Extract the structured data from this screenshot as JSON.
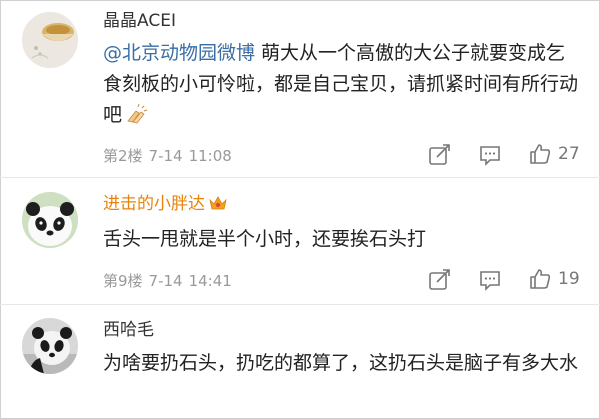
{
  "comments": [
    {
      "username": "晶晶ACEI",
      "mention": "@北京动物园微博",
      "text": " 萌大从一个高傲的大公子就要变成乞食刻板的小可怜啦，都是自己宝贝，请抓紧时间有所行动吧",
      "emoji": "clapping-hands-icon",
      "floor": "第2楼",
      "date": "7-14",
      "time": "11:08",
      "likes": "27"
    },
    {
      "username": "进击的小胖达",
      "badge": "vip-crown-icon",
      "text": "舌头一甩就是半个小时，还要挨石头打",
      "floor": "第9楼",
      "date": "7-14",
      "time": "14:41",
      "likes": "19"
    },
    {
      "username": "西哈毛",
      "text": "为啥要扔石头，扔吃的都算了，这扔石头是脑子有多大水"
    }
  ],
  "colors": {
    "mention": "#3a6ea5",
    "vip_name": "#e8830c",
    "meta": "#9a9a9a"
  }
}
